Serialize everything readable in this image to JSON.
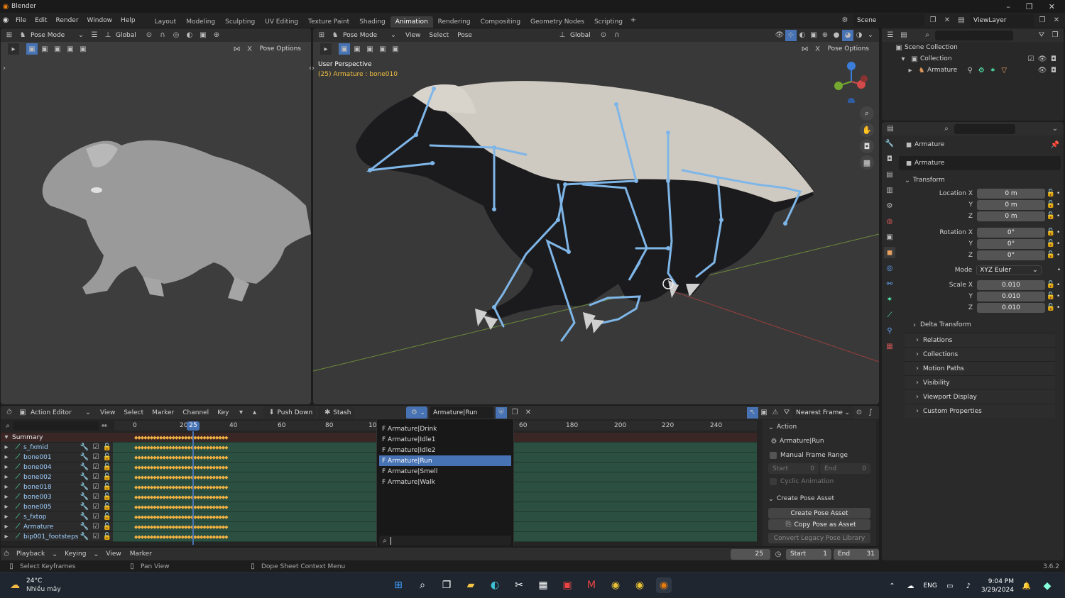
{
  "titlebar": {
    "app": "Blender"
  },
  "menus": [
    "File",
    "Edit",
    "Render",
    "Window",
    "Help"
  ],
  "workspaces": [
    "Layout",
    "Modeling",
    "Sculpting",
    "UV Editing",
    "Texture Paint",
    "Shading",
    "Animation",
    "Rendering",
    "Compositing",
    "Geometry Nodes",
    "Scripting"
  ],
  "active_workspace": "Animation",
  "scene": {
    "label": "Scene",
    "viewlayer": "ViewLayer"
  },
  "vp1": {
    "mode": "Pose Mode",
    "orientation": "Global",
    "pose_options": "Pose Options"
  },
  "vp2": {
    "mode": "Pose Mode",
    "menus": [
      "View",
      "Select",
      "Pose"
    ],
    "orientation": "Global",
    "pose_options": "Pose Options",
    "perspective": "User Perspective",
    "object_info": "(25) Armature : bone010"
  },
  "outliner": {
    "scene_collection": "Scene Collection",
    "collection": "Collection",
    "armature": "Armature"
  },
  "props": {
    "object_name": "Armature",
    "data_name": "Armature",
    "transform": "Transform",
    "location_label": "Location X",
    "location": [
      "0 m",
      "0 m",
      "0 m"
    ],
    "rotation_label": "Rotation X",
    "rotation": [
      "0°",
      "0°",
      "0°"
    ],
    "mode_label": "Mode",
    "mode_value": "XYZ Euler",
    "scale_label": "Scale X",
    "scale": [
      "0.010",
      "0.010",
      "0.010"
    ],
    "axis_y": "Y",
    "axis_z": "Z",
    "delta": "Delta Transform",
    "panels": [
      "Relations",
      "Collections",
      "Motion Paths",
      "Visibility",
      "Viewport Display",
      "Custom Properties"
    ]
  },
  "dope": {
    "editor": "Action Editor",
    "menus": [
      "View",
      "Select",
      "Marker",
      "Channel",
      "Key"
    ],
    "push_down": "Push Down",
    "stash": "Stash",
    "action": "Armature|Run",
    "snap": "Nearest Frame",
    "ruler": [
      "0",
      "20",
      "25",
      "40",
      "60",
      "80",
      "10",
      "60",
      "180",
      "200",
      "220",
      "240"
    ],
    "current_frame": "25",
    "summary": "Summary",
    "channels": [
      "s_fxmid",
      "bone001",
      "bone004",
      "bone002",
      "bone018",
      "bone003",
      "bone005",
      "s_fxtop",
      "Armature",
      "bip001_footsteps"
    ],
    "actions": [
      "F Armature|Drink",
      "F Armature|Idle1",
      "F Armature|Idle2",
      "F Armature|Run",
      "F Armature|Smell",
      "F Armature|Walk"
    ],
    "selected_action": "F Armature|Run",
    "side": {
      "action_panel": "Action",
      "action_name": "Armature|Run",
      "manual_range": "Manual Frame Range",
      "start_label": "Start",
      "start_val": "0",
      "end_label": "End",
      "end_val": "0",
      "cyclic": "Cyclic Animation",
      "pose_panel": "Create Pose Asset",
      "create_btn": "Create Pose Asset",
      "copy_btn": "Copy Pose as Asset",
      "convert_btn": "Convert Legacy Pose Library"
    }
  },
  "timeline": {
    "menus": [
      "Playback",
      "Keying",
      "View",
      "Marker"
    ],
    "frame": "25",
    "start_label": "Start",
    "start": "1",
    "end_label": "End",
    "end": "31"
  },
  "status": {
    "select": "Select Keyframes",
    "pan": "Pan View",
    "context": "Dope Sheet Context Menu",
    "version": "3.6.2"
  },
  "taskbar": {
    "temp": "24°C",
    "weather": "Nhiều mây",
    "lang": "ENG",
    "time": "9:04 PM",
    "date": "3/29/2024"
  }
}
